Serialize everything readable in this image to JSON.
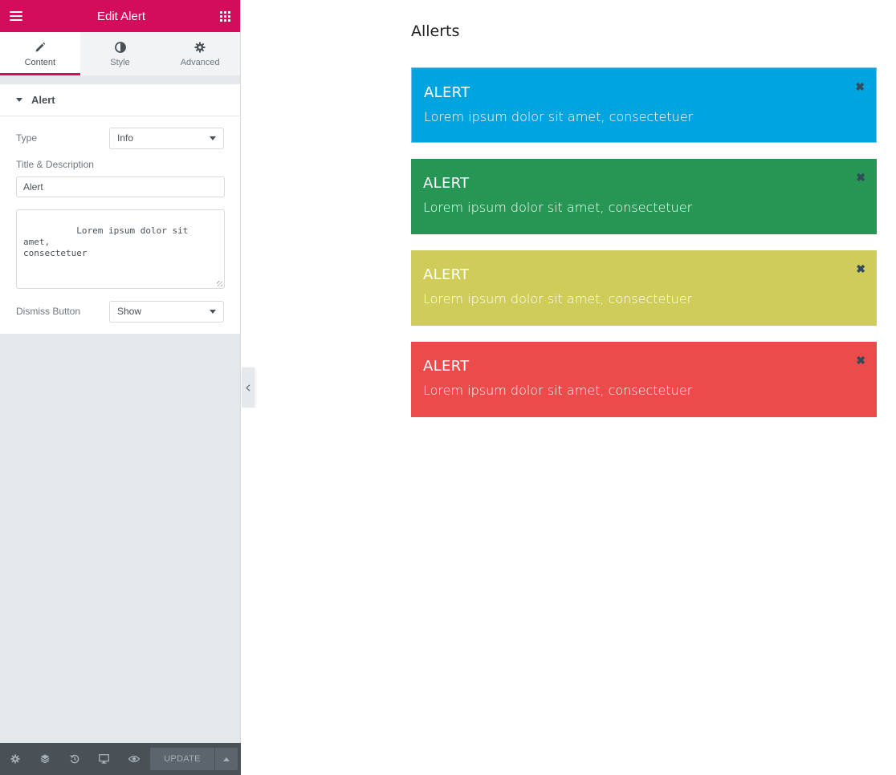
{
  "panel": {
    "title": "Edit Alert",
    "tabs": [
      {
        "label": "Content",
        "icon": "pencil-icon"
      },
      {
        "label": "Style",
        "icon": "contrast-icon"
      },
      {
        "label": "Advanced",
        "icon": "gear-icon"
      }
    ],
    "section": {
      "title": "Alert",
      "type_label": "Type",
      "type_value": "Info",
      "title_desc_label": "Title & Description",
      "title_value": "Alert",
      "description_value": "Lorem ipsum dolor sit amet,\nconsectetuer",
      "dismiss_label": "Dismiss Button",
      "dismiss_value": "Show"
    },
    "footer": {
      "update_label": "UPDATE"
    },
    "colors": {
      "brand": "#d30c5c",
      "panel_bg": "#e6e9ec",
      "footer_bg": "#495157"
    }
  },
  "preview": {
    "heading": "Allerts",
    "alerts": [
      {
        "title": "ALERT",
        "description": "Lorem ipsum dolor sit amet, consectetuer",
        "color": "#00a5e0",
        "dismiss": "✖"
      },
      {
        "title": "ALERT",
        "description": "Lorem ipsum dolor sit amet, consectetuer",
        "color": "#279654",
        "dismiss": "✖"
      },
      {
        "title": "ALERT",
        "description": "Lorem ipsum dolor sit amet, consectetuer",
        "color": "#cfcc5a",
        "dismiss": "✖"
      },
      {
        "title": "ALERT",
        "description": "Lorem ipsum dolor sit amet, consectetuer",
        "color": "#eb4b4b",
        "dismiss": "✖"
      }
    ]
  }
}
